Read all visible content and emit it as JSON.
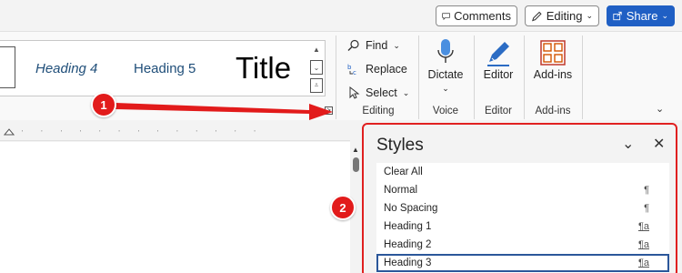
{
  "topbar": {
    "comments_label": "Comments",
    "editing_label": "Editing",
    "share_label": "Share"
  },
  "ribbon": {
    "gallery": {
      "heading4": "Heading 4",
      "heading5": "Heading 5",
      "title": "Title"
    },
    "editing": {
      "find": "Find",
      "replace": "Replace",
      "select": "Select",
      "group_label": "Editing"
    },
    "voice": {
      "dictate": "Dictate",
      "group_label": "Voice"
    },
    "editor": {
      "label": "Editor",
      "group_label": "Editor"
    },
    "addins": {
      "label": "Add-ins",
      "group_label": "Add-ins"
    }
  },
  "styles_pane": {
    "title": "Styles",
    "items": [
      {
        "label": "Clear All",
        "mark": ""
      },
      {
        "label": "Normal",
        "mark": "¶"
      },
      {
        "label": "No Spacing",
        "mark": "¶"
      },
      {
        "label": "Heading 1",
        "mark": "¶a"
      },
      {
        "label": "Heading 2",
        "mark": "¶a"
      },
      {
        "label": "Heading 3",
        "mark": "¶a",
        "selected": true
      }
    ]
  },
  "callouts": {
    "one": "1",
    "two": "2"
  },
  "colors": {
    "accent": "#1f5fc4",
    "callout": "#e21b1b",
    "heading_blue": "#1f4e79"
  }
}
